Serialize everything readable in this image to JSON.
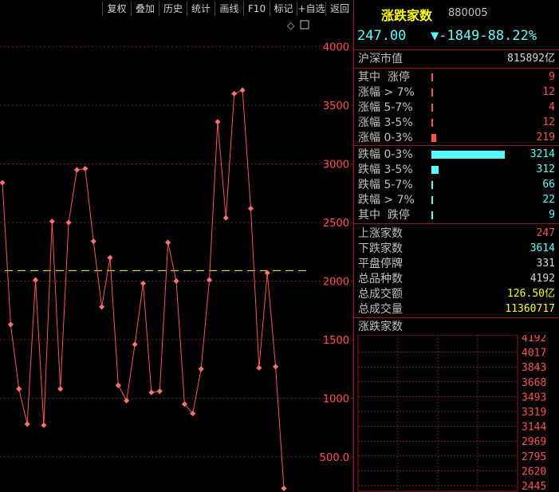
{
  "toolbar": {
    "buttons": [
      "复权",
      "叠加",
      "历史",
      "统计",
      "画线",
      "F10",
      "标记",
      "+自选",
      "返回"
    ]
  },
  "chart": {
    "y_ticks": [
      "4000",
      "3500",
      "3000",
      "2500",
      "2000",
      "1500",
      "1000",
      "500.0"
    ],
    "reference_line": 2090,
    "line_color": "#ff5050",
    "ref_color": "#ffff00"
  },
  "chart_data": {
    "type": "line",
    "ylim": [
      200,
      4250
    ],
    "values": [
      2840,
      1630,
      1080,
      780,
      2010,
      770,
      2510,
      1080,
      2500,
      2950,
      2960,
      2340,
      1780,
      2200,
      1110,
      980,
      1460,
      1980,
      1050,
      1060,
      2330,
      2000,
      950,
      870,
      1250,
      2010,
      3360,
      2540,
      3600,
      3630,
      2620,
      1260,
      2070,
      1270,
      230
    ]
  },
  "panel": {
    "title": "涨跌家数",
    "code": "880005",
    "price": "247.00",
    "change": "▼-1849-88.22%",
    "market_cap_label": "沪深市值",
    "market_cap_value": "815892亿",
    "up_rows": [
      {
        "label": "其中  涨停",
        "value": "9",
        "bar": 0.01
      },
      {
        "label": "涨幅 > 7%",
        "value": "12",
        "bar": 0.01
      },
      {
        "label": "涨幅 5-7%",
        "value": "4",
        "bar": 0.01
      },
      {
        "label": "涨幅 3-5%",
        "value": "12",
        "bar": 0.01
      },
      {
        "label": "涨幅 0-3%",
        "value": "219",
        "bar": 0.07
      }
    ],
    "down_rows": [
      {
        "label": "跌幅 0-3%",
        "value": "3214",
        "bar": 1.0
      },
      {
        "label": "跌幅 3-5%",
        "value": "312",
        "bar": 0.1
      },
      {
        "label": "跌幅 5-7%",
        "value": "66",
        "bar": 0.01
      },
      {
        "label": "跌幅 > 7%",
        "value": "22",
        "bar": 0.01
      },
      {
        "label": "其中  跌停",
        "value": "9",
        "bar": 0.01
      }
    ],
    "stats": [
      {
        "label": "上涨家数",
        "value": "247",
        "color": "red"
      },
      {
        "label": "下跌家数",
        "value": "3614",
        "color": "cyan"
      },
      {
        "label": "平盘停牌",
        "value": "331",
        "color": "white"
      },
      {
        "label": "总品种数",
        "value": "4192",
        "color": "white"
      },
      {
        "label": "总成交额",
        "value": "126.50亿",
        "color": "yellow"
      },
      {
        "label": "总成交量",
        "value": "11360717",
        "color": "yellow"
      }
    ],
    "mini_title": "涨跌家数",
    "mini_ticks": [
      "4192",
      "4017",
      "3843",
      "3668",
      "3493",
      "3319",
      "3144",
      "2969",
      "2795",
      "2620",
      "2445"
    ]
  }
}
